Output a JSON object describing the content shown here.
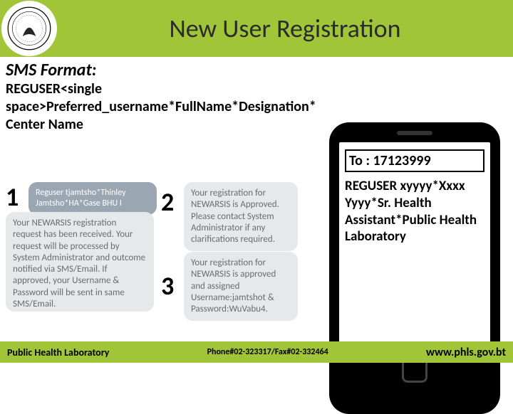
{
  "header": {
    "title": "New User Registration",
    "seal_alt": "government-seal"
  },
  "sms": {
    "heading": "SMS Format:",
    "format": "REGUSER<single space>Preferred_username*FullName*Designation* Center Name"
  },
  "steps": {
    "one": "1",
    "two": "2",
    "three": "3"
  },
  "bubbles": {
    "outgoing": "Reguser tjamtsho*Thinley Jamtsho*HA*Gase BHU I",
    "incoming1": "Your NEWARSIS registration request has been received. Your request will be processed by System Administrator and outcome notified via SMS/Email. If approved, your Username & Password will be sent in same SMS/Email.",
    "incoming2": "Your registration for NEWARSIS is Approved. Please contact System Administrator if any clarifications required.",
    "incoming3": "Your registration for NEWARSIS is approved and assigned Username:jamtshot & Password:WuVabu4."
  },
  "phone": {
    "to_label": "To : 17123999",
    "message": "REGUSER xyyyy*Xxxx Yyyy*Sr. Health Assistant*Public Health Laboratory"
  },
  "footer": {
    "left": "Public Health Laboratory",
    "mid": "Phone#02-323317/Fax#02-332464",
    "right": "www.phls.gov.bt"
  }
}
